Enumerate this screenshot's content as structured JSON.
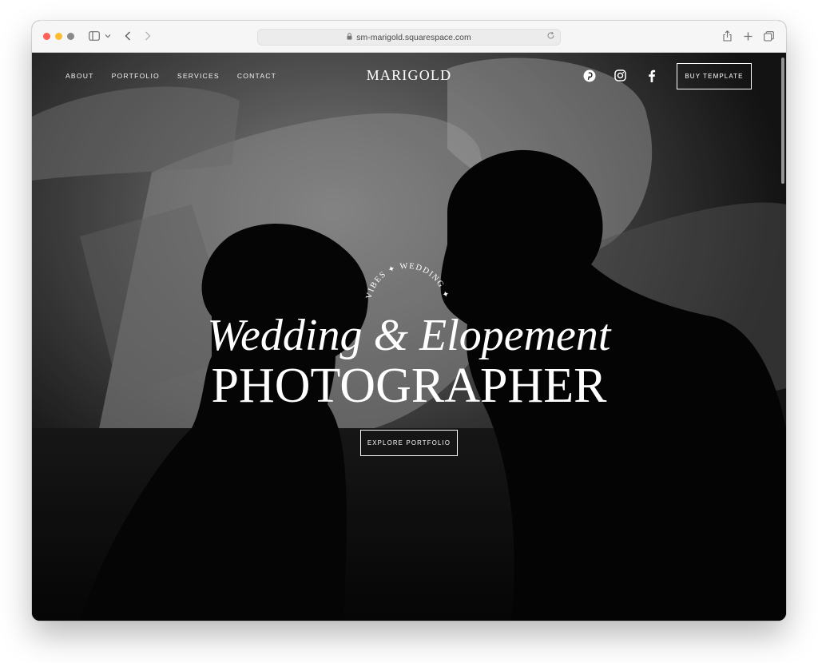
{
  "browser": {
    "url": "sm-marigold.squarespace.com"
  },
  "site": {
    "brand": "MARIGOLD",
    "nav": [
      {
        "label": "ABOUT"
      },
      {
        "label": "PORTFOLIO"
      },
      {
        "label": "SERVICES"
      },
      {
        "label": "CONTACT"
      }
    ],
    "social_icons": [
      "pinterest-icon",
      "instagram-icon",
      "facebook-icon"
    ],
    "cta_label": "BUY TEMPLATE"
  },
  "hero": {
    "arc_text": "VIBES ✦ WEDDING ✦",
    "headline": "Wedding & Elopement",
    "subheadline": "PHOTOGRAPHER",
    "button_label": "EXPLORE PORTFOLIO"
  },
  "colors": {
    "titlebar": "#f6f6f6",
    "hero_text": "#ffffff",
    "background": "#0c0c0c"
  }
}
